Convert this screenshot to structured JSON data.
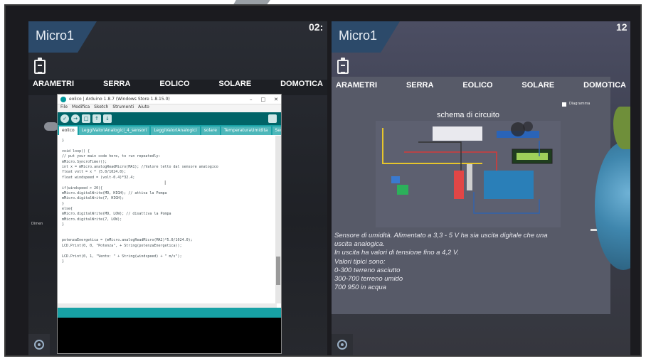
{
  "left": {
    "title": "Micro1",
    "clock": "02:",
    "menu": [
      "ARAMETRI",
      "SERRA",
      "EOLICO",
      "SOLARE",
      "DOMOTICA"
    ],
    "ide": {
      "window_title": "eolico | Arduino 1.8.7 (Windows Store 1.8.15.0)",
      "window_buttons": [
        "–",
        "□",
        "✕"
      ],
      "menubar": [
        "File",
        "Modifica",
        "Sketch",
        "Strumenti",
        "Aiuto"
      ],
      "toolbar_buttons": [
        "✓",
        "→",
        "□",
        "↑",
        "↓"
      ],
      "tabs": [
        "eolico",
        "LeggiValoriAnalogici_4_sensori",
        "LeggiValoriAnalogici",
        "solare",
        "TemperaturaUmidita",
        "Serra"
      ],
      "code_lines": [
        "}",
        "",
        "void loop() {",
        "  // put your main code here, to run repeatedly:",
        "  mMicro.SyncroTimer();",
        "  int x = mMicro.analogReadMicro(MA1); //Valore letto dal sensore analogico",
        "  float volt = x * (5.0/1024.0);",
        "  float windspeed = (volt-0.4)*32.4;",
        "",
        "  if(windspeed > 20){",
        "    mMicro.digitalWrite(MD, HIGH); // attiva la Pompa",
        "    mMicro.digitalWrite(7, HIGH);",
        "  }",
        "  else{",
        "    mMicro.digitalWrite(MD, LOW); // disattiva la Pompa",
        "    mMicro.digitalWrite(7, LOW);",
        "  }",
        "",
        "",
        "  potenzaEnergetica = (mMicro.analogReadMicro(MA2)*5.0/1024.0);",
        "  LCD.Print(0, 0, \"Potenza\", + String(potenzaEnergetica));",
        "",
        "  LCD.Print(0, 1, \"Vento: \" + String(windspeed) + \" m/s\");",
        "}"
      ],
      "cursor": "I"
    },
    "side_note": "Dimen"
  },
  "right": {
    "title": "Micro1",
    "clock": "12",
    "menu": [
      "ARAMETRI",
      "SERRA",
      "EOLICO",
      "SOLARE",
      "DOMOTICA"
    ],
    "checkbox_label": "Diagramma",
    "diagram_title": "schema di circuito",
    "sensor_text": [
      "Sensore di umidità. Alimentato a 3,3 - 5 V ha sia uscita digitale che una",
      "uscita analogica.",
      "In uscita ha valori di tensione fino a 4,2 V.",
      "Valori tipici sono:",
      "0-300 terreno asciutto",
      "300-700 terreno umido",
      "700 950 in acqua"
    ]
  },
  "colors": {
    "arduino_teal": "#00979c",
    "arduino_dark": "#006468",
    "title_tab": "#2c4a6a"
  },
  "icons": [
    "clipboard-icon",
    "gear-icon",
    "cloud-icon",
    "window-icon"
  ]
}
